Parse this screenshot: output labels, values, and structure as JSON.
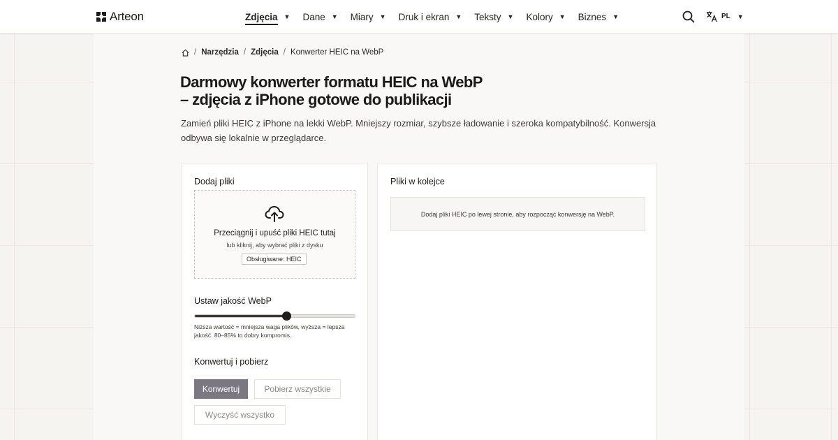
{
  "header": {
    "logo_text": "Arteon",
    "nav": [
      {
        "label": "Zdjęcia",
        "active": true
      },
      {
        "label": "Dane"
      },
      {
        "label": "Miary"
      },
      {
        "label": "Druk i ekran"
      },
      {
        "label": "Teksty"
      },
      {
        "label": "Kolory"
      },
      {
        "label": "Biznes"
      }
    ],
    "lang_code": "PL"
  },
  "breadcrumb": {
    "items": [
      "Narzędzia",
      "Zdjęcia"
    ],
    "current": "Konwerter HEIC na WebP",
    "separator": "/"
  },
  "page": {
    "title_line1": "Darmowy konwerter formatu HEIC na WebP",
    "title_line2": "– zdjęcia z iPhone gotowe do publikacji",
    "intro": "Zamień pliki HEIC z iPhone na lekki WebP. Mniejszy rozmiar, szybsze ładowanie i szeroka kompatybilność. Konwersja odbywa się lokalnie w przeglądarce."
  },
  "upload": {
    "section_title": "Dodaj pliki",
    "drop_title": "Przeciągnij i upuść pliki HEIC tutaj",
    "drop_sub": "lub kliknij, aby wybrać pliki z dysku",
    "supported": "Obsługiwane: HEIC"
  },
  "quality": {
    "section_title": "Ustaw jakość WebP",
    "value": 0.57,
    "hint": "Niższa wartość = mniejsza waga plików, wyższa = lepsza jakość. 80–85% to dobry kompromis."
  },
  "actions": {
    "section_title": "Konwertuj i pobierz",
    "convert": "Konwertuj",
    "download_all": "Pobierz wszystkie",
    "clear_all": "Wyczyść wszystko"
  },
  "queue": {
    "section_title": "Pliki w kolejce",
    "empty_text": "Dodaj pliki HEIC po lewej stronie, aby rozpocząć konwersję na WebP."
  },
  "colors": {
    "primary_button": "#7b7882",
    "text": "#1f1d1a",
    "page_bg": "#f6f4f1"
  }
}
